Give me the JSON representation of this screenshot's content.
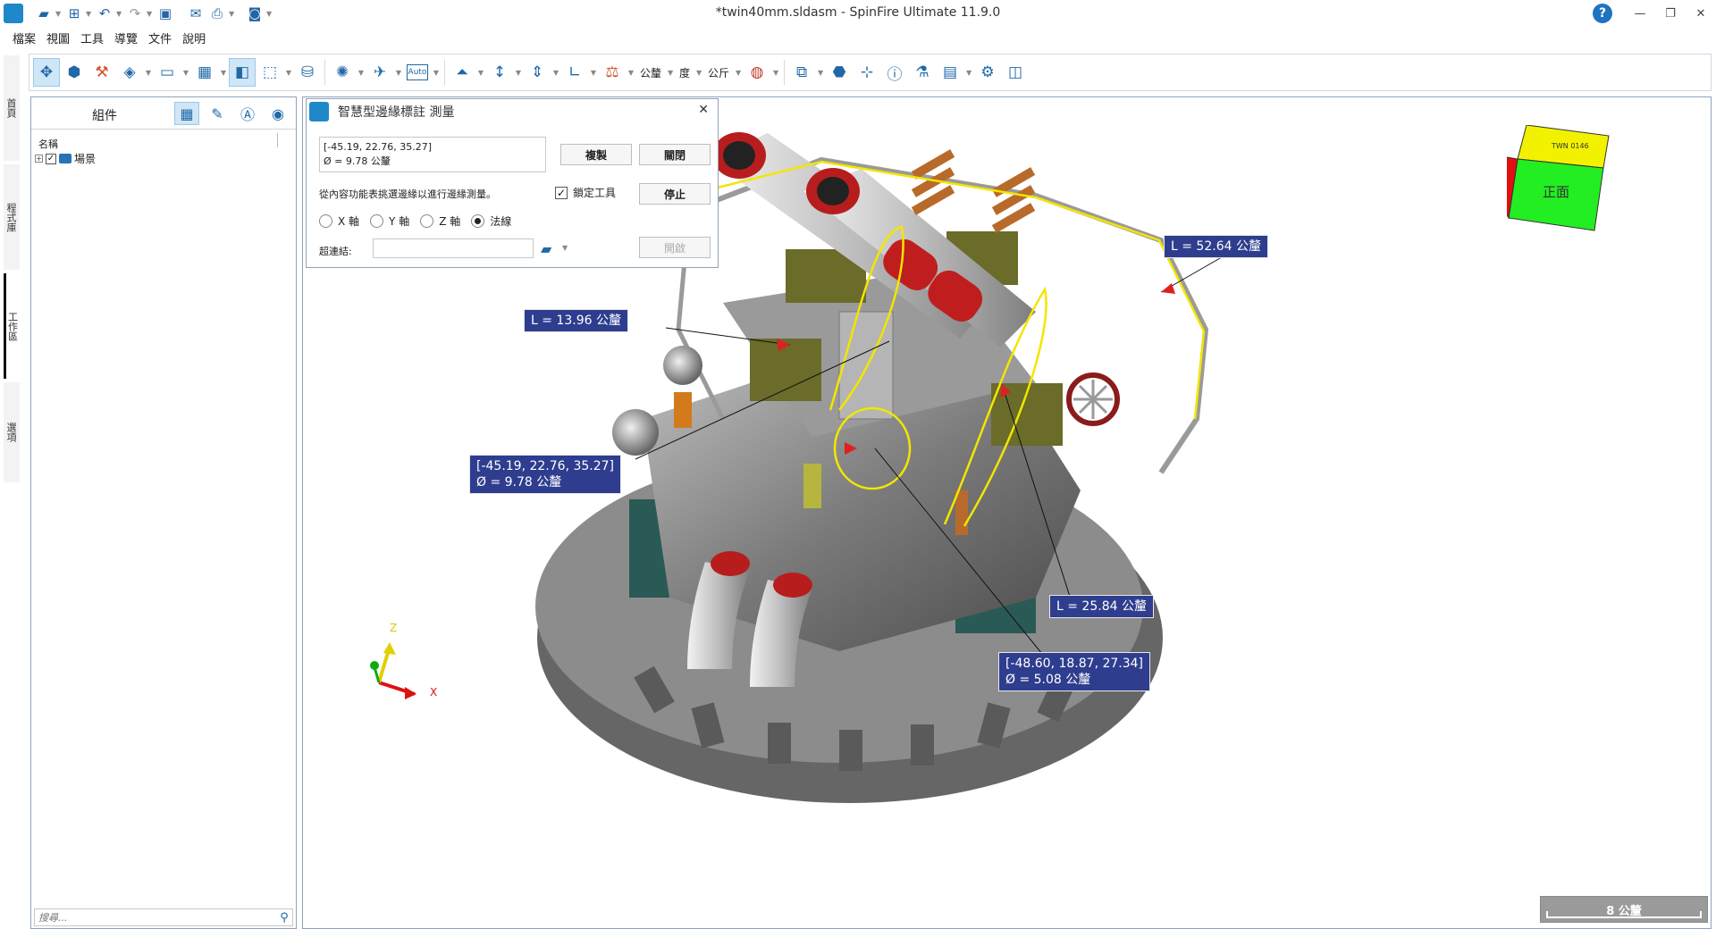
{
  "window": {
    "title": "*twin40mm.sldasm - SpinFire Ultimate 11.9.0"
  },
  "menu": [
    "檔案",
    "視圖",
    "工具",
    "導覽",
    "文件",
    "說明"
  ],
  "vertical_tabs": [
    "首頁",
    "程式庫",
    "工作區",
    "選項"
  ],
  "toolbar": {
    "units_length": "公釐",
    "units_angle": "度",
    "units_mass": "公斤",
    "auto_label": "Auto"
  },
  "panel": {
    "title": "組件",
    "column_header": "名稱",
    "tree": [
      {
        "label": "場景"
      }
    ],
    "search_placeholder": "搜尋..."
  },
  "measure_dialog": {
    "title": "智慧型邊緣標註 測量",
    "result_line1": "[-45.19, 22.76, 35.27]",
    "result_line2": "Ø = 9.78 公釐",
    "copy_label": "複製",
    "close_label": "關閉",
    "stop_label": "停止",
    "instruction": "從內容功能表挑選邊緣以進行邊緣測量。",
    "lock_label": "鎖定工具",
    "lock_checked": true,
    "axis_options": [
      "X 軸",
      "Y 軸",
      "Z 軸",
      "法線"
    ],
    "axis_selected": "法線",
    "hyperlink_label": "超連結:",
    "open_label": "開啟"
  },
  "labels": {
    "l1": "L = 13.96 公釐",
    "l2": "L = 52.64 公釐",
    "l3": "L = 25.84 公釐",
    "d1a": "[-45.19, 22.76, 35.27]",
    "d1b": "Ø = 9.78 公釐",
    "d2a": "[-48.60, 18.87, 27.34]",
    "d2b": "Ø = 5.08 公釐"
  },
  "viewcube": {
    "top_face": "TWN 0146",
    "front_face": "正面"
  },
  "axes": {
    "x": "X",
    "z": "Z"
  },
  "scale_bar": "8 公釐"
}
